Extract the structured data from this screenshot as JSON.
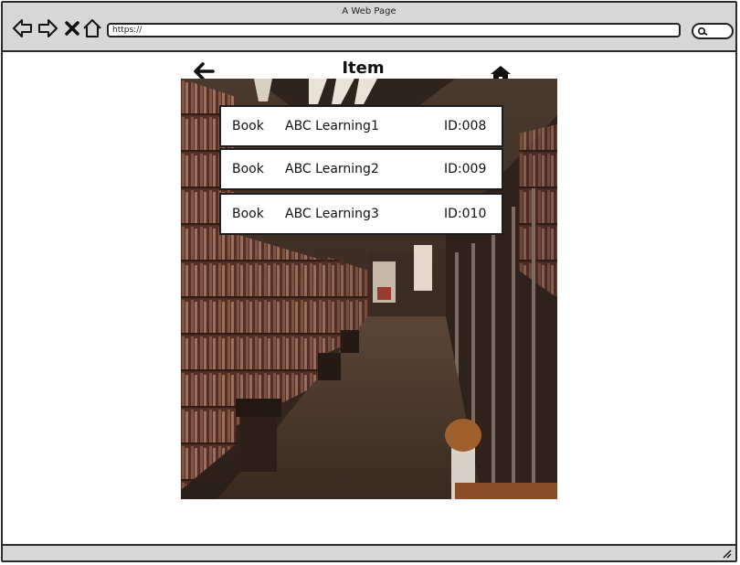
{
  "window": {
    "title": "A Web Page"
  },
  "address_bar": {
    "url": "https://"
  },
  "toolbar_icons": [
    "back-arrow-icon",
    "forward-arrow-icon",
    "close-x-icon",
    "home-icon"
  ],
  "page": {
    "title": "Item",
    "back_icon": "back-arrow-icon",
    "home_icon": "home-icon",
    "background_image": "library-corridor-photo"
  },
  "items": [
    {
      "type": "Book",
      "title": "ABC Learning1",
      "id": "ID:008"
    },
    {
      "type": "Book",
      "title": "ABC Learning2",
      "id": "ID:009"
    },
    {
      "type": "Book",
      "title": "ABC Learning3",
      "id": "ID:010"
    }
  ],
  "colors": {
    "chrome": "#d7d7d7",
    "outline": "#2b2b2b"
  }
}
